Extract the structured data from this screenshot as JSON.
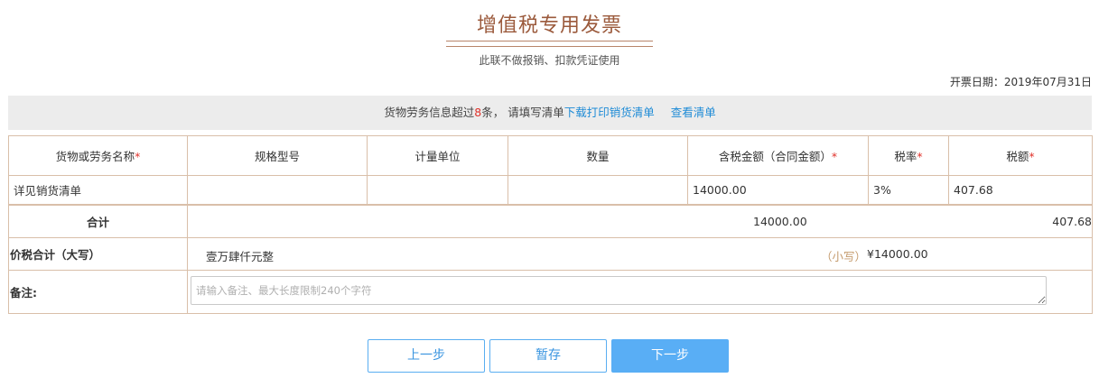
{
  "header": {
    "title": "增值税专用发票",
    "subtitle": "此联不做报销、扣款凭证使用",
    "date_label": "开票日期：",
    "date_value": "2019年07月31日"
  },
  "notice": {
    "prefix": "货物劳务信息超过",
    "count": "8",
    "suffix": "条， 请填写清单",
    "download_link": "下载打印销货清单",
    "view_link": "查看清单"
  },
  "table": {
    "columns": [
      {
        "label": "货物或劳务名称",
        "required": true
      },
      {
        "label": "规格型号",
        "required": false
      },
      {
        "label": "计量单位",
        "required": false
      },
      {
        "label": "数量",
        "required": false
      },
      {
        "label": "含税金额（合同金额）",
        "required": true
      },
      {
        "label": "税率",
        "required": true
      },
      {
        "label": "税额",
        "required": true
      }
    ],
    "required_mark": "*",
    "rows": [
      {
        "name": "详见销货清单",
        "spec": "",
        "unit": "",
        "qty": "",
        "amount": "14000.00",
        "rate": "3%",
        "tax": "407.68"
      }
    ],
    "sum_label": "合计",
    "sum_amount": "14000.00",
    "sum_tax": "407.68",
    "total_label": "价税合计（大写）",
    "total_big": "壹万肆仟元整",
    "total_small_label": "（小写）",
    "total_small": "¥14000.00",
    "remark_label": "备注:",
    "remark_placeholder": "请输入备注、最大长度限制240个字符",
    "remark_value": ""
  },
  "buttons": {
    "prev": "上一步",
    "save": "暂存",
    "next": "下一步"
  },
  "colors": {
    "title": "#9b5a3c",
    "label_accent": "#c49a6c",
    "link": "#1e8bd6",
    "required": "#e0322b",
    "primary_button": "#59aef5"
  }
}
